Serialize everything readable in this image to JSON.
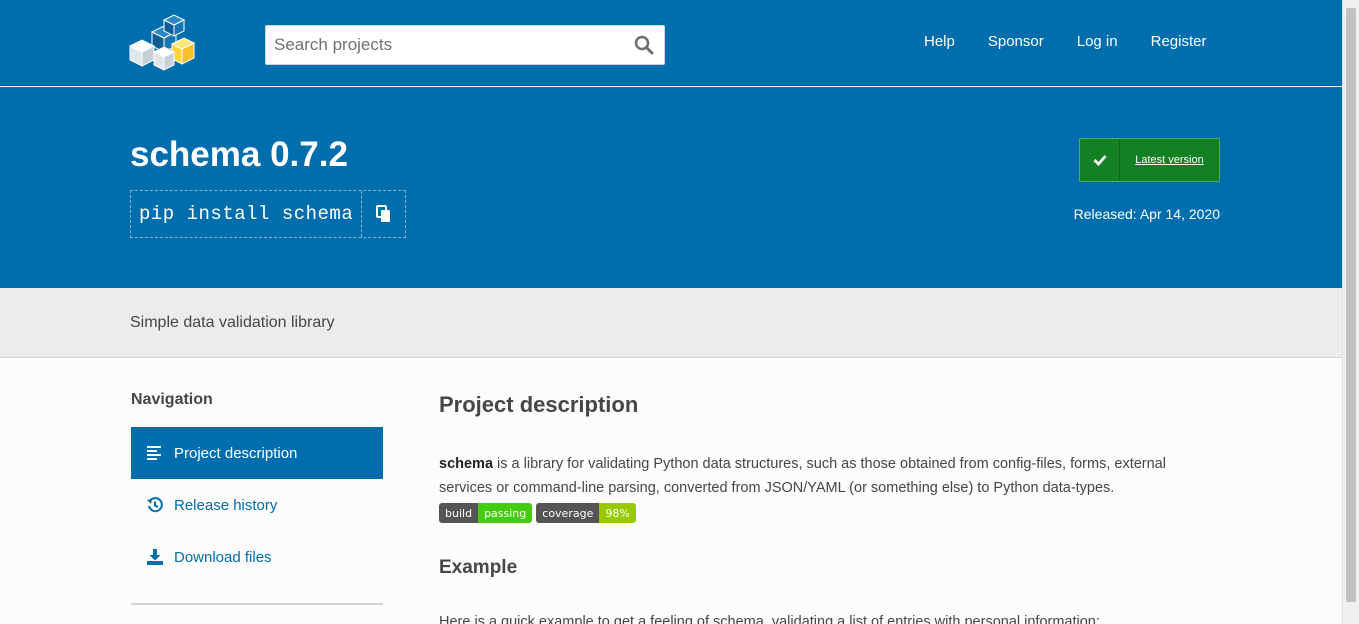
{
  "header": {
    "logo_alt": "PyPI",
    "search": {
      "placeholder": "Search projects",
      "value": ""
    },
    "nav": [
      {
        "label": "Help"
      },
      {
        "label": "Sponsor"
      },
      {
        "label": "Log in"
      },
      {
        "label": "Register"
      }
    ]
  },
  "package": {
    "title": "schema 0.7.2",
    "install_command": "pip install schema",
    "latest_label": "Latest version",
    "released": "Released: Apr 14, 2020",
    "summary": "Simple data validation library"
  },
  "sidebar": {
    "title": "Navigation",
    "items": [
      {
        "label": "Project description",
        "icon": "align-left-icon",
        "active": true
      },
      {
        "label": "Release history",
        "icon": "history-icon",
        "active": false
      },
      {
        "label": "Download files",
        "icon": "download-icon",
        "active": false
      }
    ]
  },
  "content": {
    "heading": "Project description",
    "desc_strong": "schema",
    "desc_rest": " is a library for validating Python data structures, such as those obtained from config-files, forms, external services or command-line parsing, converted from JSON/YAML (or something else) to Python data-types.",
    "badges": [
      {
        "left": "build",
        "right": "passing"
      },
      {
        "left": "coverage",
        "right": "98%"
      }
    ],
    "example_heading": "Example",
    "cut_line": "Here is a quick example to get a feeling of schema, validating a list of entries with personal information:"
  },
  "colors": {
    "brand_blue": "#006dad",
    "latest_green": "#148024",
    "badge_passing": "#44cc11",
    "badge_coverage": "#97ca00"
  }
}
